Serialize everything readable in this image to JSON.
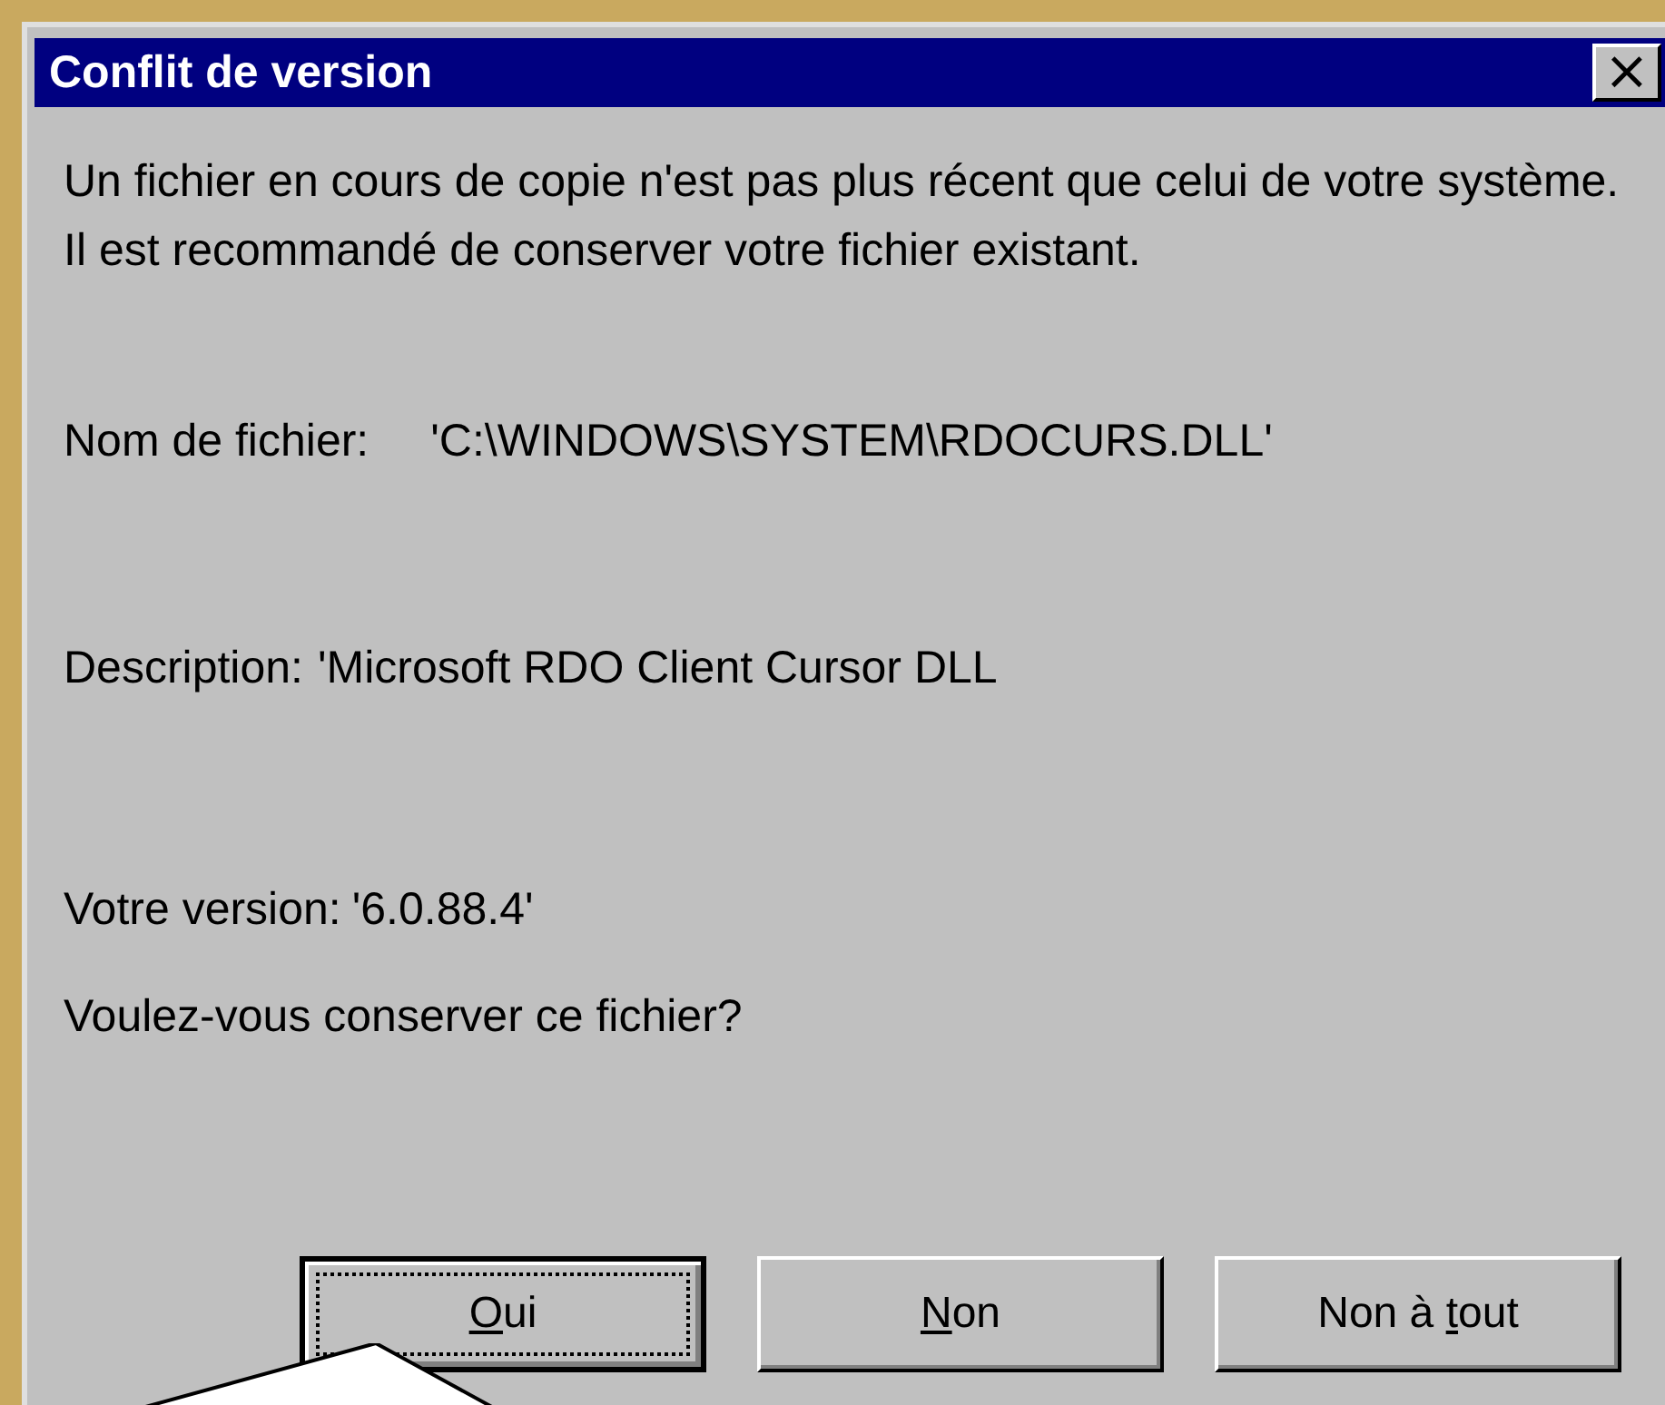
{
  "window": {
    "title": "Conflit de version",
    "close": "×"
  },
  "message": "Un fichier en cours de copie n'est pas plus récent que celui de votre système. Il est recommandé de conserver votre fichier existant.",
  "fields": [
    {
      "label": "Nom de fichier:",
      "value": "'C:\\WINDOWS\\SYSTEM\\RDOCURS.DLL'"
    },
    {
      "label": "Description:",
      "value": "'Microsoft RDO Client Cursor DLL"
    },
    {
      "label": "Votre version:",
      "value": "'6.0.88.4'"
    }
  ],
  "question": "Voulez-vous conserver ce fichier?",
  "buttons": [
    {
      "key": "O",
      "rest": "ui",
      "focused": true
    },
    {
      "key": "N",
      "rest": "on",
      "focused": false
    },
    {
      "lead": "Non à ",
      "key": "t",
      "rest": "out",
      "focused": false
    }
  ]
}
